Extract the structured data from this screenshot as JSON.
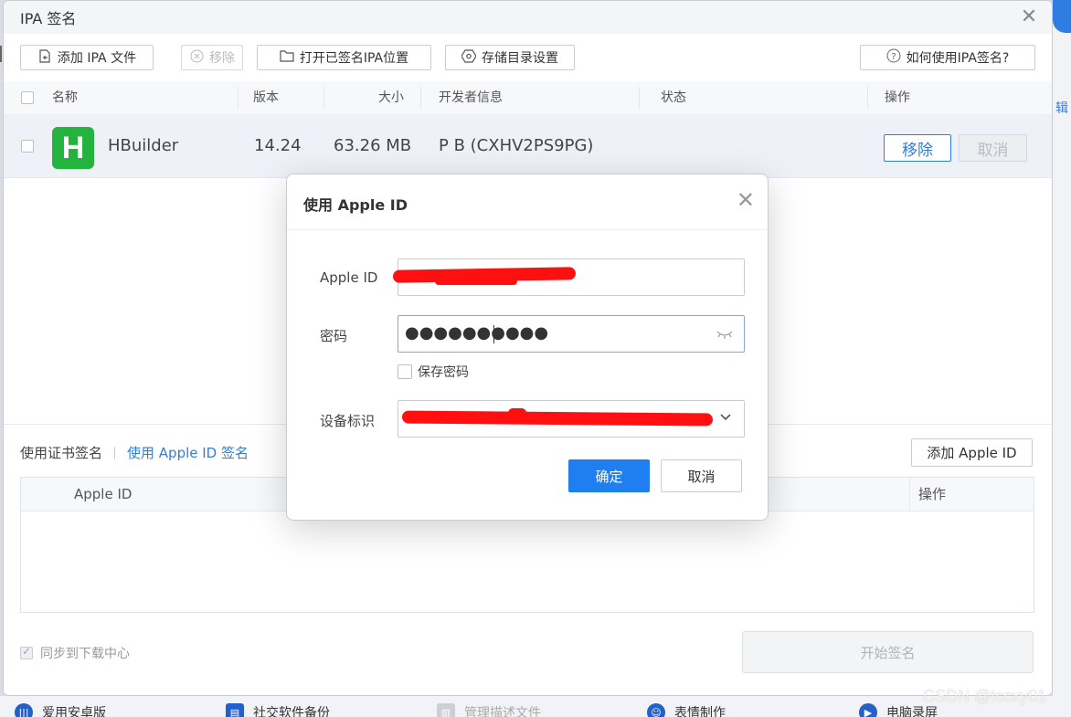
{
  "window": {
    "title": "IPA 签名",
    "close_glyph": "✕"
  },
  "toolbar": {
    "add_ipa": "添加 IPA 文件",
    "remove": "移除",
    "open_signed_location": "打开已签名IPA位置",
    "storage_settings": "存储目录设置",
    "help": "如何使用IPA签名?"
  },
  "table": {
    "headers": {
      "name": "名称",
      "version": "版本",
      "size": "大小",
      "developer": "开发者信息",
      "status": "状态",
      "action": "操作"
    },
    "rows": [
      {
        "icon_letter": "H",
        "name": "HBuilder",
        "version": "14.24",
        "size": "63.26 MB",
        "developer": "P B (CXHV2PS9PG)",
        "status": "",
        "remove_label": "移除",
        "cancel_label": "取消"
      }
    ]
  },
  "sign_mode": {
    "certificate": "使用证书签名",
    "apple_id": "使用 Apple ID 签名",
    "add_apple_id": "添加 Apple ID"
  },
  "apple_id_table": {
    "col_apple_id": "Apple ID",
    "col_action": "操作"
  },
  "footer": {
    "sync_label": "同步到下载中心",
    "start_sign": "开始签名"
  },
  "dialog": {
    "title": "使用 Apple ID",
    "apple_id_label": "Apple ID",
    "password_label": "密码",
    "password_masked": "●●●●●●●●●●",
    "save_password_label": "保存密码",
    "device_label": "设备标识",
    "ok": "确定",
    "cancel": "取消"
  },
  "taskbar": {
    "items": [
      "爱用安卓版",
      "社交软件备份",
      "管理描述文件",
      "表情制作",
      "电脑录屏"
    ]
  },
  "side_text": "辑",
  "watermark": "CSDN @tccxy01",
  "colors": {
    "accent": "#1f7ef0",
    "app_icon": "#25b33f",
    "redaction": "#ff1010"
  }
}
